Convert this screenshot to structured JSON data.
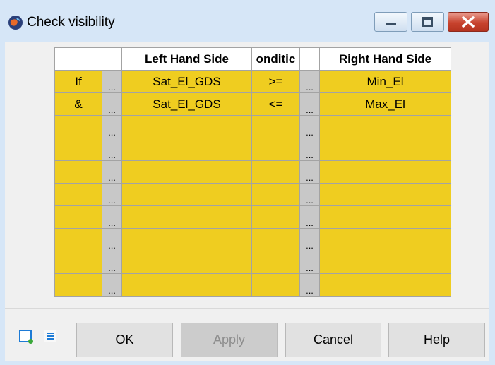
{
  "window": {
    "title": "Check visibility",
    "icon": "globe-icon"
  },
  "titlebar_buttons": {
    "minimize_icon": "minimize-icon",
    "maximize_icon": "maximize-icon",
    "close_icon": "close-icon"
  },
  "grid": {
    "headers": [
      "",
      "",
      "Left Hand Side",
      "onditic",
      "",
      "Right Hand Side"
    ],
    "rows": [
      {
        "op": "If",
        "lhs_dots": "...",
        "lhs": "Sat_El_GDS",
        "cond": ">=",
        "rhs_dots": "...",
        "rhs": "Min_El"
      },
      {
        "op": "&",
        "lhs_dots": "...",
        "lhs": "Sat_El_GDS",
        "cond": "<=",
        "rhs_dots": "...",
        "rhs": "Max_El"
      },
      {
        "op": "",
        "lhs_dots": "...",
        "lhs": "",
        "cond": "",
        "rhs_dots": "...",
        "rhs": ""
      },
      {
        "op": "",
        "lhs_dots": "...",
        "lhs": "",
        "cond": "",
        "rhs_dots": "...",
        "rhs": ""
      },
      {
        "op": "",
        "lhs_dots": "...",
        "lhs": "",
        "cond": "",
        "rhs_dots": "...",
        "rhs": ""
      },
      {
        "op": "",
        "lhs_dots": "...",
        "lhs": "",
        "cond": "",
        "rhs_dots": "...",
        "rhs": ""
      },
      {
        "op": "",
        "lhs_dots": "...",
        "lhs": "",
        "cond": "",
        "rhs_dots": "...",
        "rhs": ""
      },
      {
        "op": "",
        "lhs_dots": "...",
        "lhs": "",
        "cond": "",
        "rhs_dots": "...",
        "rhs": ""
      },
      {
        "op": "",
        "lhs_dots": "...",
        "lhs": "",
        "cond": "",
        "rhs_dots": "...",
        "rhs": ""
      },
      {
        "op": "",
        "lhs_dots": "...",
        "lhs": "",
        "cond": "",
        "rhs_dots": "...",
        "rhs": ""
      }
    ]
  },
  "footer": {
    "icons": [
      "new-row-icon",
      "list-icon"
    ],
    "ok_label": "OK",
    "apply_label": "Apply",
    "cancel_label": "Cancel",
    "help_label": "Help"
  },
  "colors": {
    "row_fill": "#efcd20",
    "dots_fill": "#c8c8c8",
    "title_bg": "#d6e6f7",
    "close_button": "#c8432e"
  }
}
